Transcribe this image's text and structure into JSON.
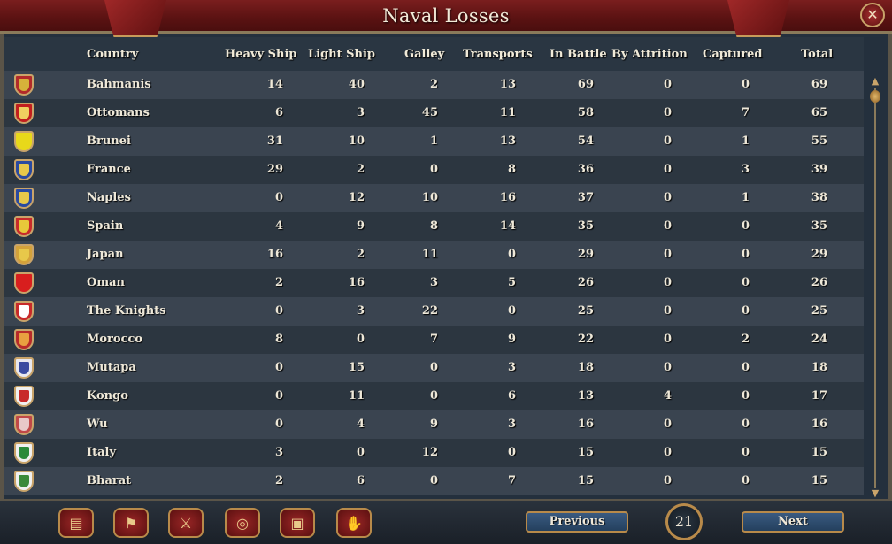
{
  "window": {
    "title": "Naval Losses",
    "close_icon": "close-icon"
  },
  "columns": [
    "Country",
    "Heavy Ship",
    "Light Ship",
    "Galley",
    "Transports",
    "In Battle",
    "By Attrition",
    "Captured",
    "Total"
  ],
  "rows": [
    {
      "flag": "#b22a2a",
      "accent": "#d6b23a",
      "country": "Bahmanis",
      "heavy": "14",
      "light": "40",
      "galley": "2",
      "transports": "13",
      "battle": "69",
      "attrition": "0",
      "captured": "0",
      "total": "69"
    },
    {
      "flag": "#c21e1e",
      "accent": "#f0d060",
      "country": "Ottomans",
      "heavy": "6",
      "light": "3",
      "galley": "45",
      "transports": "11",
      "battle": "58",
      "attrition": "0",
      "captured": "7",
      "total": "65"
    },
    {
      "flag": "#e8d81a",
      "accent": "#e8d81a",
      "country": "Brunei",
      "heavy": "31",
      "light": "10",
      "galley": "1",
      "transports": "13",
      "battle": "54",
      "attrition": "0",
      "captured": "1",
      "total": "55"
    },
    {
      "flag": "#2a4aa0",
      "accent": "#e8c84a",
      "country": "France",
      "heavy": "29",
      "light": "2",
      "galley": "0",
      "transports": "8",
      "battle": "36",
      "attrition": "0",
      "captured": "3",
      "total": "39"
    },
    {
      "flag": "#2a4aa0",
      "accent": "#e8c84a",
      "country": "Naples",
      "heavy": "0",
      "light": "12",
      "galley": "10",
      "transports": "16",
      "battle": "37",
      "attrition": "0",
      "captured": "1",
      "total": "38"
    },
    {
      "flag": "#c82a2a",
      "accent": "#e8c83a",
      "country": "Spain",
      "heavy": "4",
      "light": "9",
      "galley": "8",
      "transports": "14",
      "battle": "35",
      "attrition": "0",
      "captured": "0",
      "total": "35"
    },
    {
      "flag": "#d4a23a",
      "accent": "#e8c84a",
      "country": "Japan",
      "heavy": "16",
      "light": "2",
      "galley": "11",
      "transports": "0",
      "battle": "29",
      "attrition": "0",
      "captured": "0",
      "total": "29"
    },
    {
      "flag": "#d81e1e",
      "accent": "#d81e1e",
      "country": "Oman",
      "heavy": "2",
      "light": "16",
      "galley": "3",
      "transports": "5",
      "battle": "26",
      "attrition": "0",
      "captured": "0",
      "total": "26"
    },
    {
      "flag": "#c82a2a",
      "accent": "#ffffff",
      "country": "The Knights",
      "heavy": "0",
      "light": "3",
      "galley": "22",
      "transports": "0",
      "battle": "25",
      "attrition": "0",
      "captured": "0",
      "total": "25"
    },
    {
      "flag": "#b82a2a",
      "accent": "#e8a040",
      "country": "Morocco",
      "heavy": "8",
      "light": "0",
      "galley": "7",
      "transports": "9",
      "battle": "22",
      "attrition": "0",
      "captured": "2",
      "total": "24"
    },
    {
      "flag": "#e8e8f0",
      "accent": "#3a4aa0",
      "country": "Mutapa",
      "heavy": "0",
      "light": "15",
      "galley": "0",
      "transports": "3",
      "battle": "18",
      "attrition": "0",
      "captured": "0",
      "total": "18"
    },
    {
      "flag": "#f0f0f0",
      "accent": "#c82a2a",
      "country": "Kongo",
      "heavy": "0",
      "light": "11",
      "galley": "0",
      "transports": "6",
      "battle": "13",
      "attrition": "4",
      "captured": "0",
      "total": "17"
    },
    {
      "flag": "#c04848",
      "accent": "#e8c8c8",
      "country": "Wu",
      "heavy": "0",
      "light": "4",
      "galley": "9",
      "transports": "3",
      "battle": "16",
      "attrition": "0",
      "captured": "0",
      "total": "16"
    },
    {
      "flag": "#f0f0f0",
      "accent": "#2a8a3a",
      "country": "Italy",
      "heavy": "3",
      "light": "0",
      "galley": "12",
      "transports": "0",
      "battle": "15",
      "attrition": "0",
      "captured": "0",
      "total": "15"
    },
    {
      "flag": "#f0f0f0",
      "accent": "#3a8a3a",
      "country": "Bharat",
      "heavy": "2",
      "light": "6",
      "galley": "0",
      "transports": "7",
      "battle": "15",
      "attrition": "0",
      "captured": "0",
      "total": "15"
    }
  ],
  "bottom": {
    "icons": [
      "ledger-icon",
      "flag-icon",
      "crossed-swords-icon",
      "coins-icon",
      "trade-goods-icon",
      "handshake-icon"
    ],
    "previous_label": "Previous",
    "next_label": "Next",
    "page": "21"
  }
}
